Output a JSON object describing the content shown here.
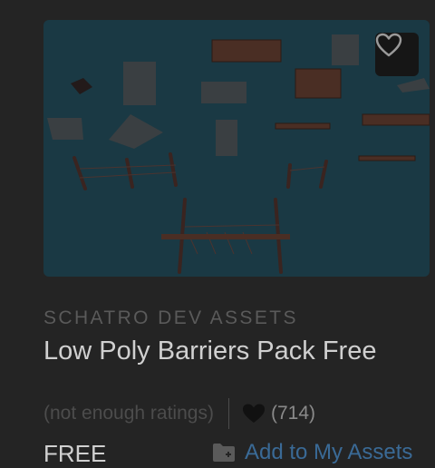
{
  "product": {
    "publisher": "SCHATRO DEV ASSETS",
    "title": "Low Poly Barriers Pack Free",
    "rating_text": "(not enough ratings)",
    "favorites": "(714)",
    "price": "FREE",
    "add_label": "Add to My Assets"
  },
  "icons": {
    "wishlist": "heart-outline-icon",
    "favorites": "heart-icon",
    "add": "folder-plus-icon"
  },
  "colors": {
    "background": "#242424",
    "thumbnail": "#1a3944",
    "link": "#3a6a96"
  }
}
